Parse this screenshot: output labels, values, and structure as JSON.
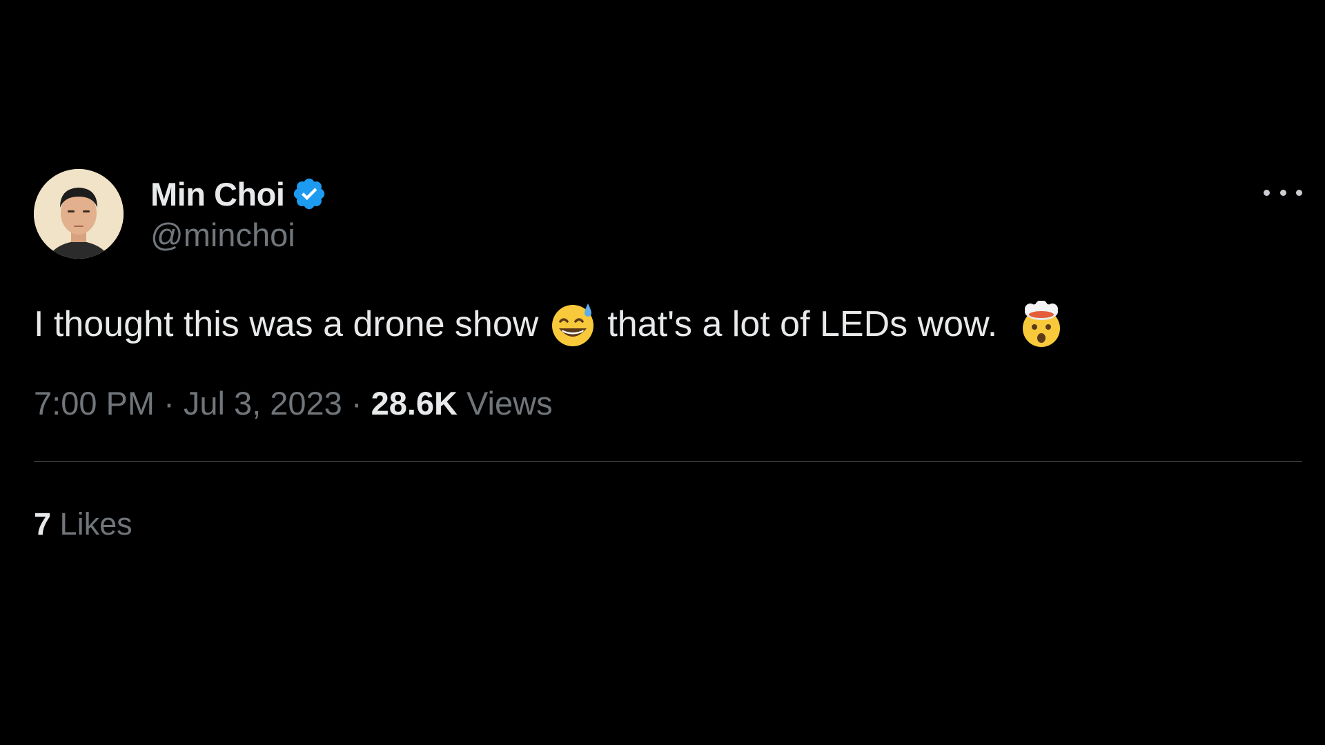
{
  "tweet": {
    "author": {
      "display_name": "Min Choi",
      "handle": "@minchoi",
      "verified": true,
      "verified_color": "#1d9bf0"
    },
    "text_before": "I thought this was a drone show",
    "emoji_1": "grinning-face-with-sweat",
    "text_middle": "that's a lot of LEDs wow.",
    "emoji_2": "exploding-head",
    "time": "7:00 PM",
    "date": "Jul 3, 2023",
    "separator": "·",
    "views_count": "28.6K",
    "views_label": "Views",
    "likes_count": "7",
    "likes_label": "Likes"
  },
  "colors": {
    "background": "#000000",
    "primary_text": "#e7e9ea",
    "secondary_text": "#71767b",
    "divider": "#2f3336"
  }
}
